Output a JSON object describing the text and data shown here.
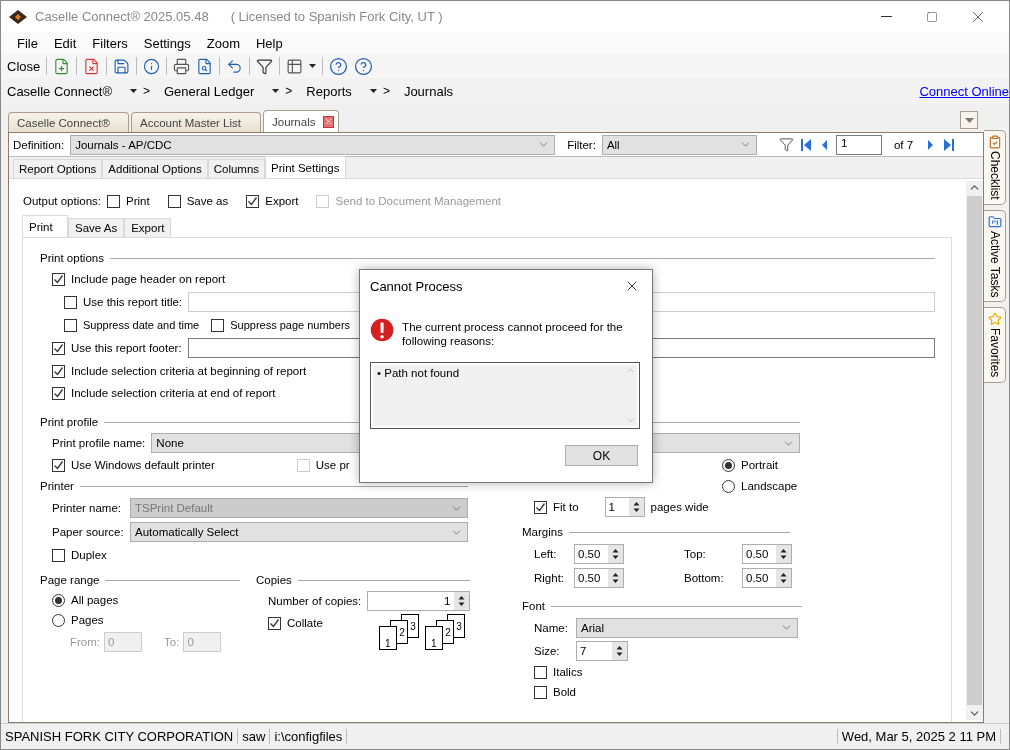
{
  "window": {
    "title": "Caselle Connect® 2025.05.48",
    "license": "( Licensed to Spanish Fork City, UT )"
  },
  "menu": [
    "File",
    "Edit",
    "Filters",
    "Settings",
    "Zoom",
    "Help"
  ],
  "toolbar": {
    "close": "Close"
  },
  "breadcrumb": {
    "items": [
      "Caselle Connect®",
      "General Ledger",
      "Reports",
      "Journals"
    ],
    "separator": ">",
    "link": "Connect Online"
  },
  "doc_tabs": [
    {
      "label": "Caselle Connect®",
      "selected": false
    },
    {
      "label": "Account Master List",
      "selected": false
    },
    {
      "label": "Journals",
      "selected": true
    }
  ],
  "definition": {
    "label": "Definition:",
    "value": "Journals - AP/CDC"
  },
  "filter": {
    "label": "Filter:",
    "value": "All"
  },
  "pager": {
    "page": "1",
    "of": "of 7"
  },
  "side_tabs": [
    "Checklist",
    "Active Tasks",
    "Favorites"
  ],
  "report_tabs": [
    {
      "label": "Report Options",
      "selected": false
    },
    {
      "label": "Additional Options",
      "selected": false
    },
    {
      "label": "Columns",
      "selected": false
    },
    {
      "label": "Print Settings",
      "selected": true
    }
  ],
  "output_options": {
    "label": "Output options:",
    "items": [
      {
        "label": "Print",
        "checked": false,
        "disabled": false
      },
      {
        "label": "Save as",
        "checked": false,
        "disabled": false
      },
      {
        "label": "Export",
        "checked": true,
        "disabled": false
      },
      {
        "label": "Send to Document Management",
        "checked": false,
        "disabled": true
      }
    ]
  },
  "inner_tabs": [
    {
      "label": "Print",
      "selected": true
    },
    {
      "label": "Save As",
      "selected": false
    },
    {
      "label": "Export",
      "selected": false
    }
  ],
  "print_options": {
    "title": "Print options",
    "items": [
      {
        "kind": "check",
        "label": "Include page header on report",
        "checked": true,
        "children": [
          {
            "kind": "field",
            "label": "Use this report title:",
            "checked": false
          },
          {
            "kind": "pair",
            "items": [
              {
                "label": "Suppress date and time",
                "checked": false
              },
              {
                "label": "Suppress page numbers",
                "checked": false
              }
            ]
          }
        ]
      },
      {
        "kind": "field",
        "label": "Use this report footer:",
        "checked": true
      },
      {
        "kind": "check",
        "label": "Include selection criteria at beginning of report",
        "checked": true
      },
      {
        "kind": "check",
        "label": "Include selection criteria at end of report",
        "checked": true
      }
    ]
  },
  "print_profile": {
    "title": "Print profile",
    "name_label": "Print profile name:",
    "name_value": "None",
    "default_printer": {
      "label": "Use Windows default printer",
      "checked": true
    },
    "other": {
      "label": "Use pr",
      "checked": false,
      "disabled": true
    }
  },
  "orientation": [
    {
      "label": "Portrait",
      "selected": true
    },
    {
      "label": "Landscape",
      "selected": false
    }
  ],
  "printer": {
    "title": "Printer",
    "rows": [
      {
        "label": "Printer name:",
        "value": "TSPrint Default",
        "disabled": true
      },
      {
        "label": "Paper source:",
        "value": "Automatically Select",
        "disabled": false
      }
    ],
    "duplex": {
      "label": "Duplex",
      "checked": false
    }
  },
  "page_range": {
    "title": "Page range",
    "options": [
      {
        "label": "All pages",
        "selected": true
      },
      {
        "label": "Pages",
        "selected": false
      }
    ],
    "from": {
      "label": "From:",
      "value": "0"
    },
    "to": {
      "label": "To:",
      "value": "0"
    },
    "disabled": true
  },
  "copies": {
    "title": "Copies",
    "label": "Number of copies:",
    "value": "1",
    "collate": {
      "label": "Collate",
      "checked": true
    },
    "stacks": [
      [
        "1",
        "2",
        "3"
      ],
      [
        "1",
        "2",
        "3"
      ]
    ]
  },
  "fit": {
    "label": "Fit to",
    "checked": true,
    "value": "1",
    "suffix": "pages wide"
  },
  "margins": {
    "title": "Margins",
    "items": [
      {
        "label": "Left:",
        "value": "0.50"
      },
      {
        "label": "Top:",
        "value": "0.50"
      },
      {
        "label": "Right:",
        "value": "0.50"
      },
      {
        "label": "Bottom:",
        "value": "0.50"
      }
    ]
  },
  "font": {
    "title": "Font",
    "name_label": "Name:",
    "name_value": "Arial",
    "size_label": "Size:",
    "size_value": "7",
    "options": [
      {
        "label": "Italics",
        "checked": false
      },
      {
        "label": "Bold",
        "checked": false
      }
    ]
  },
  "dialog": {
    "title": "Cannot Process",
    "message": "The current process cannot proceed for the following reasons:",
    "bullet": "•",
    "reasons": [
      "Path not found"
    ],
    "button": "OK"
  },
  "status": [
    "SPANISH FORK CITY CORPORATION",
    "saw",
    "i:\\configfiles",
    "Wed, Mar 5, 2025 2 11 PM"
  ]
}
